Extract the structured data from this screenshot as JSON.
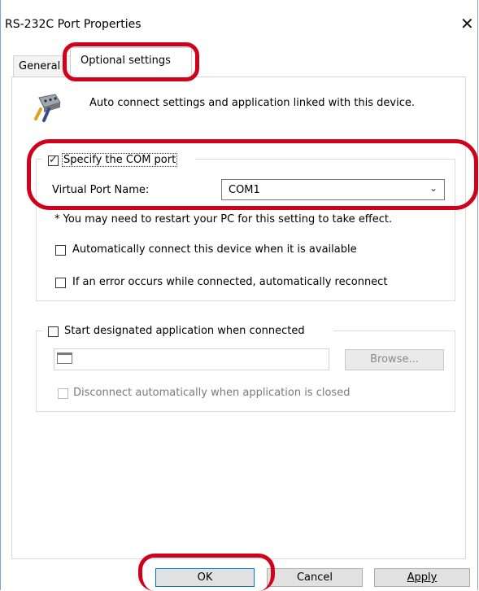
{
  "window": {
    "title": "RS-232C Port Properties"
  },
  "tabs": [
    {
      "label": "General",
      "active": false
    },
    {
      "label": "Optional settings",
      "active": true
    }
  ],
  "header": {
    "description": "Auto connect settings and application linked with this device.",
    "icon": "serial-port-plug-icon"
  },
  "com_group": {
    "specify_label": "Specify the COM port",
    "specify_checked": true,
    "port_name_label": "Virtual Port Name:",
    "port_value": "COM1",
    "note": "* You may need to restart your PC for this setting to take effect.",
    "auto_connect_label": "Automatically connect this device when it is available",
    "auto_connect_checked": false,
    "reconnect_label": "If an error occurs while connected, automatically reconnect",
    "reconnect_checked": false
  },
  "app_group": {
    "start_label": "Start designated application when connected",
    "start_checked": false,
    "path_value": "",
    "browse_label": "Browse...",
    "disconnect_label": "Disconnect automatically when application is closed",
    "disconnect_checked": false
  },
  "footer": {
    "ok_label": "OK",
    "cancel_label": "Cancel",
    "apply_label": "Apply"
  },
  "colors": {
    "highlight": "#d0021b",
    "window_border": "#7fa3c9",
    "button_face": "#e1e1e1"
  }
}
